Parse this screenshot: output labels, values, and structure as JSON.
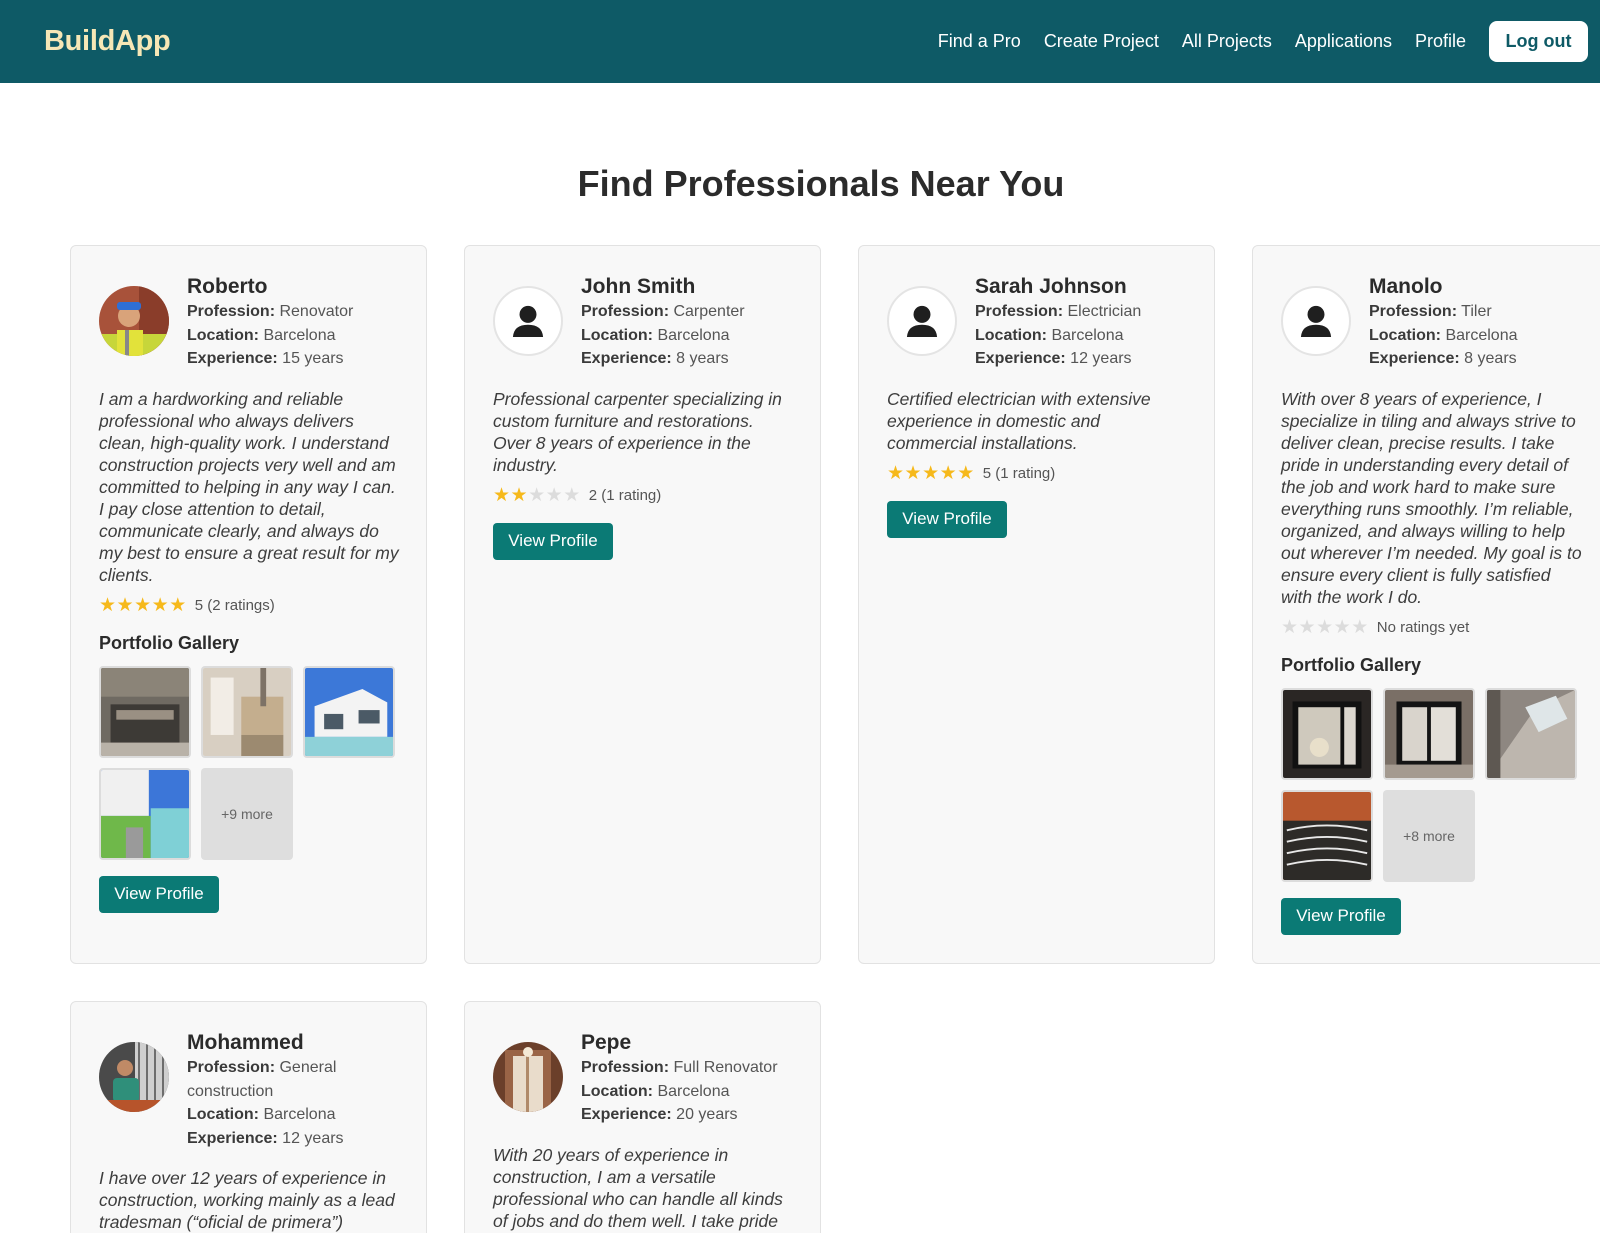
{
  "nav": {
    "brand": "BuildApp",
    "links": [
      "Find a Pro",
      "Create Project",
      "All Projects",
      "Applications",
      "Profile"
    ],
    "logout": "Log out"
  },
  "page": {
    "title": "Find Professionals Near You"
  },
  "labels": {
    "profession": "Profession:",
    "location": "Location:",
    "experience": "Experience:",
    "gallery": "Portfolio Gallery",
    "view_profile": "View Profile"
  },
  "pros": [
    {
      "name": "Roberto",
      "profession": "Renovator",
      "location": "Barcelona",
      "experience": "15 years",
      "bio": "I am a hardworking and reliable professional who always delivers clean, high-quality work. I understand construction projects very well and am committed to helping in any way I can. I pay close attention to detail, communicate clearly, and always do my best to ensure a great result for my clients.",
      "stars": 5,
      "rating_text": "5 (2 ratings)",
      "gallery_more": "+9 more"
    },
    {
      "name": "John Smith",
      "profession": "Carpenter",
      "location": "Barcelona",
      "experience": "8 years",
      "bio": "Professional carpenter specializing in custom furniture and restorations. Over 8 years of experience in the industry.",
      "stars": 2,
      "rating_text": "2 (1 rating)"
    },
    {
      "name": "Sarah Johnson",
      "profession": "Electrician",
      "location": "Barcelona",
      "experience": "12 years",
      "bio": "Certified electrician with extensive experience in domestic and commercial installations.",
      "stars": 5,
      "rating_text": "5 (1 rating)"
    },
    {
      "name": "Manolo",
      "profession": "Tiler",
      "location": "Barcelona",
      "experience": "8 years",
      "bio": "With over 8 years of experience, I specialize in tiling and always strive to deliver clean, precise results. I take pride in understanding every detail of the job and work hard to make sure everything runs smoothly. I’m reliable, organized, and always willing to help out wherever I’m needed. My goal is to ensure every client is fully satisfied with the work I do.",
      "stars": 0,
      "rating_text": "No ratings yet",
      "gallery_more": "+8 more"
    },
    {
      "name": "Mohammed",
      "profession": "General construction",
      "location": "Barcelona",
      "experience": "12 years",
      "bio": "I have over 12 years of experience in construction, working mainly as a lead tradesman (“oficial de primera”)"
    },
    {
      "name": "Pepe",
      "profession": "Full Renovator",
      "location": "Barcelona",
      "experience": "20 years",
      "bio": "With 20 years of experience in construction, I am a versatile professional who can handle all kinds of jobs and do them well. I take pride"
    }
  ]
}
